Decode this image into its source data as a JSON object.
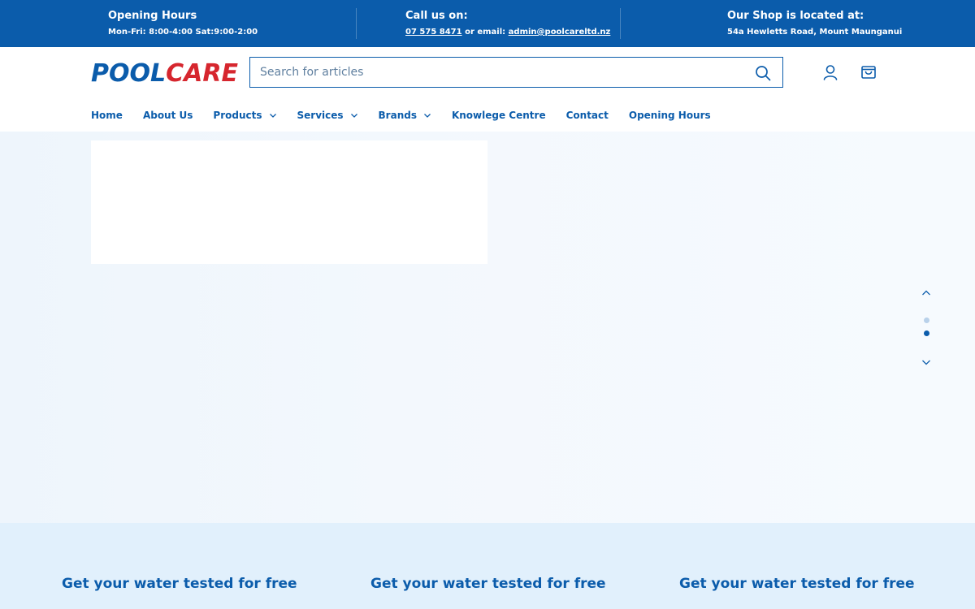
{
  "topbar": {
    "hours": {
      "heading": "Opening Hours",
      "detail": "Mon-Fri: 8:00-4:00 Sat:9:00-2:00"
    },
    "call": {
      "heading": "Call us on:",
      "phone": "07 575 8471",
      "mid": " or email: ",
      "email": "admin@poolcareltd.nz"
    },
    "shop": {
      "heading": "Our Shop is located at:",
      "address": "54a Hewletts Road, Mount Maunganui"
    }
  },
  "header": {
    "logo": {
      "part1": "POOL",
      "part2": "CARE"
    },
    "search": {
      "placeholder": "Search for articles",
      "value": ""
    },
    "icons": {
      "account": "user-icon",
      "cart": "cart-icon",
      "search": "search-icon"
    }
  },
  "nav": {
    "items": [
      {
        "label": "Home",
        "dropdown": false
      },
      {
        "label": "About Us",
        "dropdown": false
      },
      {
        "label": "Products",
        "dropdown": true
      },
      {
        "label": "Services",
        "dropdown": true
      },
      {
        "label": "Brands",
        "dropdown": true
      },
      {
        "label": "Knowlege Centre",
        "dropdown": false
      },
      {
        "label": "Contact",
        "dropdown": false
      },
      {
        "label": "Opening Hours",
        "dropdown": false
      }
    ]
  },
  "slider": {
    "dots": 2,
    "active_index": 1
  },
  "features": {
    "items": [
      {
        "title": "Get your water tested for free"
      },
      {
        "title": "Get your water tested for free"
      },
      {
        "title": "Get your water tested for free"
      }
    ]
  },
  "colors": {
    "brand_blue": "#0b5cab",
    "brand_red": "#d6262e",
    "feature_bg": "#e1f0fc"
  }
}
